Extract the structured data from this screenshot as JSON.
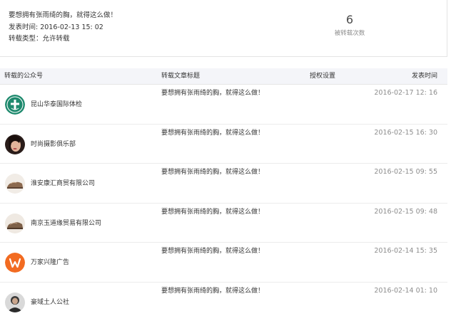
{
  "summary": {
    "title": "要想拥有张雨绮的胸，就得这么做！",
    "publish_time": "发表时间: 2016-02-13 15: 02",
    "repost_type": "转载类型：允许转载",
    "repost_count": "6",
    "repost_count_label": "被转载次数"
  },
  "table": {
    "headers": {
      "account": "转载的公众号",
      "article_title": "转载文章标题",
      "authorization": "授权设置",
      "publish_time": "发表时间"
    },
    "rows": [
      {
        "account": "昆山华泰国际体检",
        "title": "要想拥有张雨绮的胸，就得这么做！",
        "time": "2016-02-17 12: 16",
        "avatar": "hospital-logo-icon"
      },
      {
        "account": "时尚摄影俱乐部",
        "title": "要想拥有张雨绮的胸，就得这么做！",
        "time": "2016-02-15 16: 30",
        "avatar": "woman-portrait-avatar"
      },
      {
        "account": "淮安康汇商贸有限公司",
        "title": "要想拥有张雨绮的胸，就得这么做！",
        "time": "2016-02-15 09: 55",
        "avatar": "shoe-photo-avatar"
      },
      {
        "account": "南京玉道缘贸易有限公司",
        "title": "要想拥有张雨绮的胸，就得这么做！",
        "time": "2016-02-15 09: 48",
        "avatar": "shoe-photo-avatar"
      },
      {
        "account": "万家兴隆广告",
        "title": "要想拥有张雨绮的胸，就得这么做！",
        "time": "2016-02-14 15: 35",
        "avatar": "orange-w-logo-icon"
      },
      {
        "account": "豪域土人公社",
        "title": "要想拥有张雨绮的胸，就得这么做！",
        "time": "2016-02-14 01: 10",
        "avatar": "person-photo-avatar"
      }
    ]
  },
  "colors": {
    "header_bg": "#f4f5f9",
    "muted_text": "#8d8d8d",
    "body_text": "#353535",
    "hospital_green": "#1f8a6e",
    "logo_orange": "#f26b21"
  }
}
